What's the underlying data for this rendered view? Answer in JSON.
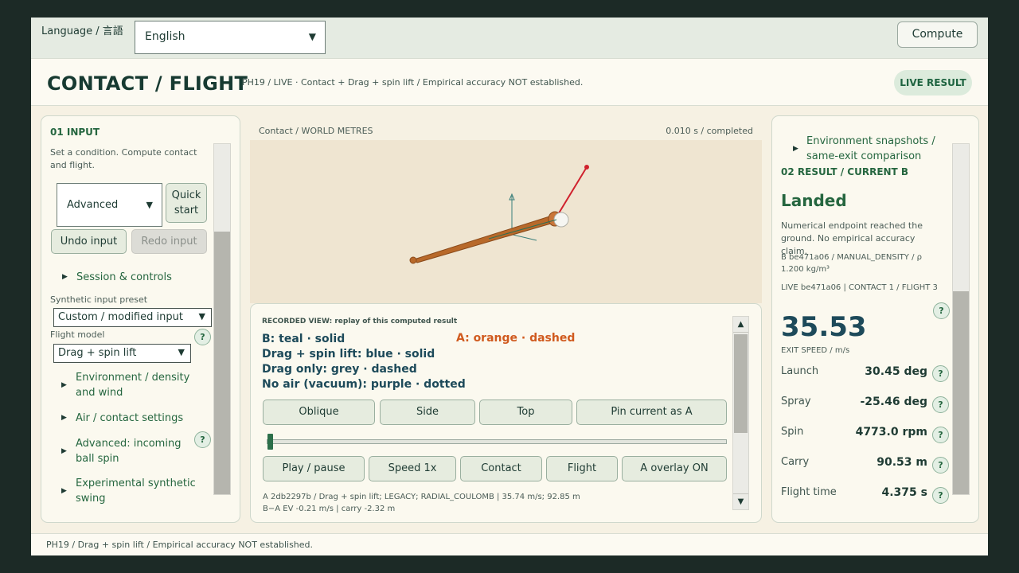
{
  "topbar": {
    "language_label": "Language / 言語",
    "language_value": "English",
    "compute_label": "Compute"
  },
  "header": {
    "title": "CONTACT / FLIGHT",
    "subtitle": "PH19 / LIVE · Contact + Drag + spin lift / Empirical accuracy NOT established.",
    "live_badge": "LIVE RESULT"
  },
  "input_panel": {
    "title": "01  INPUT",
    "description": "Set a condition. Compute contact and flight.",
    "mode_select": "Advanced",
    "quick_start": "Quick start",
    "undo": "Undo input",
    "redo": "Redo input",
    "session_controls": "Session & controls",
    "preset_label": "Synthetic input preset",
    "preset_value": "Custom / modified input",
    "flight_model_label": "Flight model",
    "flight_model_value": "Drag + spin lift",
    "sections": [
      "Environment / density and wind",
      "Air / contact settings",
      "Advanced: incoming ball spin",
      "Experimental synthetic swing"
    ]
  },
  "viewport": {
    "label": "Contact / WORLD METRES",
    "time": "0.010 s / completed"
  },
  "replay": {
    "heading": "RECORDED VIEW: replay of this computed result",
    "legend_b": "B: teal · solid",
    "legend_a": "A: orange · dashed",
    "legend_lift": "Drag + spin lift: blue · solid",
    "legend_drag": "Drag only: grey · dashed",
    "legend_vacuum": "No air (vacuum): purple · dotted",
    "view_buttons": [
      "Oblique",
      "Side",
      "Top",
      "Pin current as A"
    ],
    "play_buttons": [
      "Play / pause",
      "Speed 1x",
      "Contact",
      "Flight",
      "A overlay ON"
    ],
    "progress": 0.0,
    "note_line1": "A 2db2297b / Drag + spin lift; LEGACY; RADIAL_COULOMB | 35.74 m/s; 92.85 m",
    "note_line2": "B−A EV -0.21 m/s | carry -2.32 m"
  },
  "result_panel": {
    "snapshots": "Environment snapshots / same-exit comparison",
    "title": "02  RESULT / CURRENT B",
    "status": "Landed",
    "status_note": "Numerical endpoint reached the ground. No empirical accuracy claim.",
    "meta1": "B be471a06 / MANUAL_DENSITY / ρ 1.200 kg/m³",
    "meta2": "LIVE be471a06 | CONTACT 1 / FLIGHT 3",
    "exit_speed": "35.53",
    "exit_speed_label": "EXIT SPEED / m/s",
    "metrics": [
      {
        "label": "Launch",
        "value": "30.45 deg"
      },
      {
        "label": "Spray",
        "value": "-25.46 deg"
      },
      {
        "label": "Spin",
        "value": "4773.0 rpm"
      },
      {
        "label": "Carry",
        "value": "90.53 m"
      },
      {
        "label": "Flight time",
        "value": "4.375 s"
      }
    ]
  },
  "footer": {
    "text": "PH19 / Drag + spin lift / Empirical accuracy NOT established."
  },
  "colors": {
    "accent_green": "#25663f",
    "bat": "#b8692a",
    "trajectory": "#d0222e",
    "axis": "#3a7f7a"
  }
}
